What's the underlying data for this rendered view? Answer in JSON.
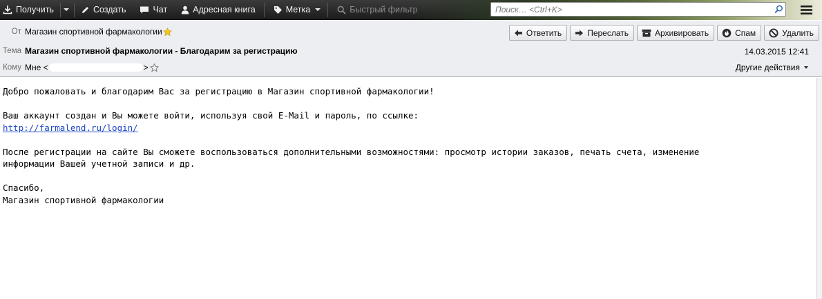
{
  "toolbar": {
    "get_label": "Получить",
    "compose_label": "Создать",
    "chat_label": "Чат",
    "addressbook_label": "Адресная книга",
    "tag_label": "Метка",
    "quickfilter_label": "Быстрый фильтр",
    "search_placeholder": "Поиск… <Ctrl+K>"
  },
  "header": {
    "from_label": "От",
    "from_value": "Магазин спортивной фармакологии",
    "subject_label": "Тема",
    "subject_value": "Магазин спортивной фармакологии - Благодарим за регистрацию",
    "to_label": "Кому",
    "to_prefix": "Мне <",
    "to_suffix": ">",
    "date": "14.03.2015 12:41",
    "other_actions": "Другие действия",
    "buttons": {
      "reply": "Ответить",
      "forward": "Переслать",
      "archive": "Архивировать",
      "spam": "Спам",
      "delete": "Удалить"
    }
  },
  "message": {
    "line1": "Добро пожаловать и благодарим Вас за регистрацию в Магазин спортивной фармакологии!",
    "line2": "Ваш аккаунт создан и Вы можете войти, используя свой E-Mail и пароль, по ссылке:",
    "link": "http://farmalend.ru/login/",
    "line3": "После регистрации на сайте Вы сможете воспользоваться дополнительными возможностями: просмотр истории заказов, печать счета, изменение",
    "line4": "информации Вашей учетной записи и др.",
    "line5": "Спасибо,",
    "line6": "Магазин спортивной фармакологии"
  },
  "colors": {
    "toolbar_bg": "#262626",
    "header_bg": "#eceef1",
    "link": "#1a44c8",
    "star": "#f5c518"
  },
  "icons": [
    "download-icon",
    "pencil-icon",
    "chat-bubble-icon",
    "person-icon",
    "tag-icon",
    "filter-icon",
    "search-icon",
    "hamburger-menu-icon",
    "star-icon",
    "reply-arrow-icon",
    "forward-arrow-icon",
    "archive-box-icon",
    "spam-flame-icon",
    "delete-circle-icon"
  ]
}
